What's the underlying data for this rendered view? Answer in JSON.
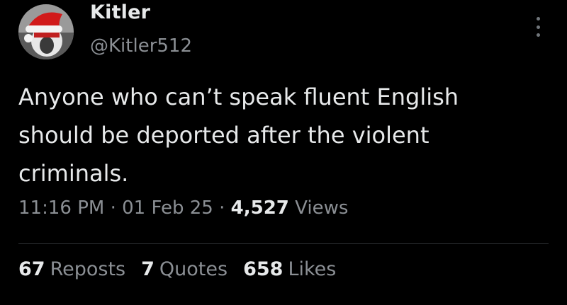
{
  "author": {
    "display_name": "Kitler",
    "handle": "@Kitler512"
  },
  "tweet": {
    "text": "Anyone who can’t speak fluent English\nshould be deported after the violent\ncriminals.",
    "time": "11:16 PM",
    "date": "01 Feb 25",
    "separator": "·",
    "views_count": "4,527",
    "views_label": "Views"
  },
  "stats": {
    "reposts_count": "67",
    "reposts_label": "Reposts",
    "quotes_count": "7",
    "quotes_label": "Quotes",
    "likes_count": "658",
    "likes_label": "Likes"
  },
  "icons": {
    "avatar": "cat-in-santa-hat-avatar",
    "more": "more-vertical-icon"
  },
  "colors": {
    "background": "#000000",
    "primary_text": "#e7e9ea",
    "secondary_text": "#8b8f94",
    "divider": "#2f3336"
  }
}
